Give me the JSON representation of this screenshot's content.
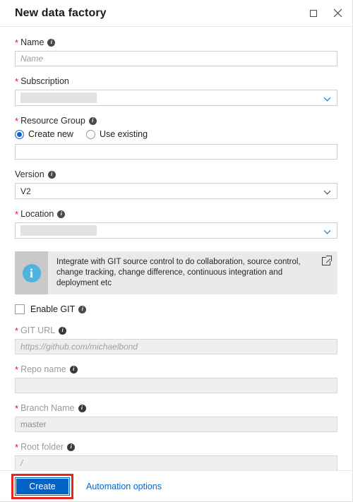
{
  "window": {
    "title": "New data factory",
    "maximize_icon": "maximize-square-icon",
    "close_icon": "close-x-icon"
  },
  "form": {
    "name": {
      "label": "Name",
      "required": true,
      "info_icon": "info-icon",
      "placeholder": "Name",
      "value": ""
    },
    "subscription": {
      "label": "Subscription",
      "required": true,
      "value": "",
      "redacted": true,
      "chevron_icon": "chevron-down-icon"
    },
    "resource_group": {
      "label": "Resource Group",
      "required": true,
      "info_icon": "info-icon",
      "options": [
        {
          "label": "Create new",
          "selected": true
        },
        {
          "label": "Use existing",
          "selected": false
        }
      ],
      "value": "",
      "placeholder": ""
    },
    "version": {
      "label": "Version",
      "required": false,
      "info_icon": "info-icon",
      "value": "V2",
      "chevron_icon": "chevron-down-icon"
    },
    "location": {
      "label": "Location",
      "required": true,
      "info_icon": "info-icon",
      "value": "",
      "redacted": true,
      "chevron_icon": "chevron-down-icon"
    }
  },
  "banner": {
    "icon": "info-circle-icon",
    "text": "Integrate with GIT source control to do collaboration, source control, change tracking, change difference, continuous integration and deployment etc",
    "link_icon": "external-link-icon"
  },
  "enable_git": {
    "label": "Enable GIT",
    "checked": false,
    "info_icon": "info-icon"
  },
  "git": {
    "url": {
      "label": "GIT URL",
      "required": true,
      "info_icon": "info-icon",
      "placeholder": "https://github.com/michaelbond",
      "disabled": true
    },
    "repo_name": {
      "label": "Repo name",
      "required": true,
      "info_icon": "info-icon",
      "placeholder": "",
      "disabled": true
    },
    "branch_name": {
      "label": "Branch Name",
      "required": true,
      "info_icon": "info-icon",
      "value": "master",
      "disabled": true
    },
    "root_folder": {
      "label": "Root folder",
      "required": true,
      "info_icon": "info-icon",
      "placeholder": "/",
      "disabled": true
    }
  },
  "footer": {
    "create_label": "Create",
    "automation_label": "Automation options"
  },
  "colors": {
    "primary_button": "#0063c8",
    "link": "#0066cc",
    "required_asterisk": "#e81123",
    "highlight_box": "#e8251e",
    "banner_bg": "#eaeaea",
    "banner_icon_bg": "#c9c9c9",
    "info_circle": "#4fb3e0",
    "redacted_block": "#e2e2e2"
  }
}
